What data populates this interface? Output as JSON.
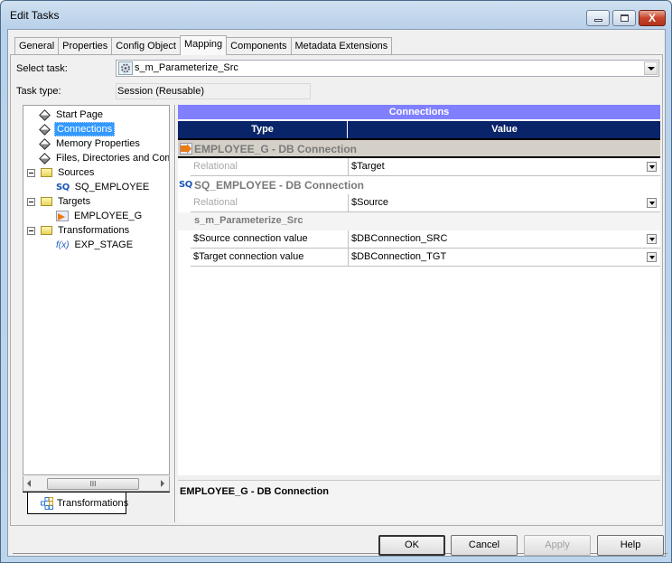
{
  "window": {
    "title": "Edit Tasks",
    "controls": {
      "minimize": "",
      "maximize": "",
      "close": "X"
    }
  },
  "tabs": [
    {
      "label": "General",
      "active": false
    },
    {
      "label": "Properties",
      "active": false
    },
    {
      "label": "Config Object",
      "active": false
    },
    {
      "label": "Mapping",
      "active": true
    },
    {
      "label": "Components",
      "active": false
    },
    {
      "label": "Metadata Extensions",
      "active": false
    }
  ],
  "form": {
    "select_task_label": "Select task:",
    "select_task_value": "s_m_Parameterize_Src",
    "task_type_label": "Task type:",
    "task_type_value": "Session (Reusable)"
  },
  "tree": {
    "items": [
      {
        "label": "Start Page",
        "icon": "diamond-icon",
        "level": 0
      },
      {
        "label": "Connections",
        "icon": "diamond-icon",
        "level": 0,
        "selected": true
      },
      {
        "label": "Memory Properties",
        "icon": "diamond-icon",
        "level": 0
      },
      {
        "label": "Files, Directories and Commands",
        "icon": "diamond-icon",
        "level": 0
      },
      {
        "label": "Sources",
        "icon": "folder-icon",
        "level": 0,
        "expanded": true
      },
      {
        "label": "SQ_EMPLOYEE",
        "icon": "source-qualifier-icon",
        "level": 1
      },
      {
        "label": "Targets",
        "icon": "folder-icon",
        "level": 0,
        "expanded": true
      },
      {
        "label": "EMPLOYEE_G",
        "icon": "target-icon",
        "level": 1
      },
      {
        "label": "Transformations",
        "icon": "folder-icon",
        "level": 0,
        "expanded": true
      },
      {
        "label": "EXP_STAGE",
        "icon": "expression-icon",
        "level": 1
      }
    ],
    "scroll_thumb": "III",
    "bottom_tab": "Transformations",
    "sq_glyph": "SQ",
    "fx_glyph": "f(x)"
  },
  "grid": {
    "title": "Connections",
    "columns": [
      "Type",
      "Value"
    ],
    "groups": [
      {
        "name": "EMPLOYEE_G - DB Connection",
        "icon": "target-icon",
        "selected": true,
        "rows": [
          {
            "type": "Relational",
            "value": "$Target",
            "type_dim": true
          }
        ]
      },
      {
        "name": "SQ_EMPLOYEE - DB Connection",
        "icon": "source-qualifier-icon",
        "selected": false,
        "rows": [
          {
            "type": "Relational",
            "value": "$Source",
            "type_dim": true
          }
        ]
      },
      {
        "name": "s_m_Parameterize_Src",
        "icon": "",
        "selected": false,
        "rows": [
          {
            "type": "$Source connection value",
            "value": "$DBConnection_SRC",
            "type_dim": false
          },
          {
            "type": "$Target connection value",
            "value": "$DBConnection_TGT",
            "type_dim": false
          }
        ]
      }
    ]
  },
  "description": {
    "text": "EMPLOYEE_G - DB Connection"
  },
  "buttons": {
    "ok": "OK",
    "cancel": "Cancel",
    "apply": "Apply",
    "help": "Help"
  }
}
